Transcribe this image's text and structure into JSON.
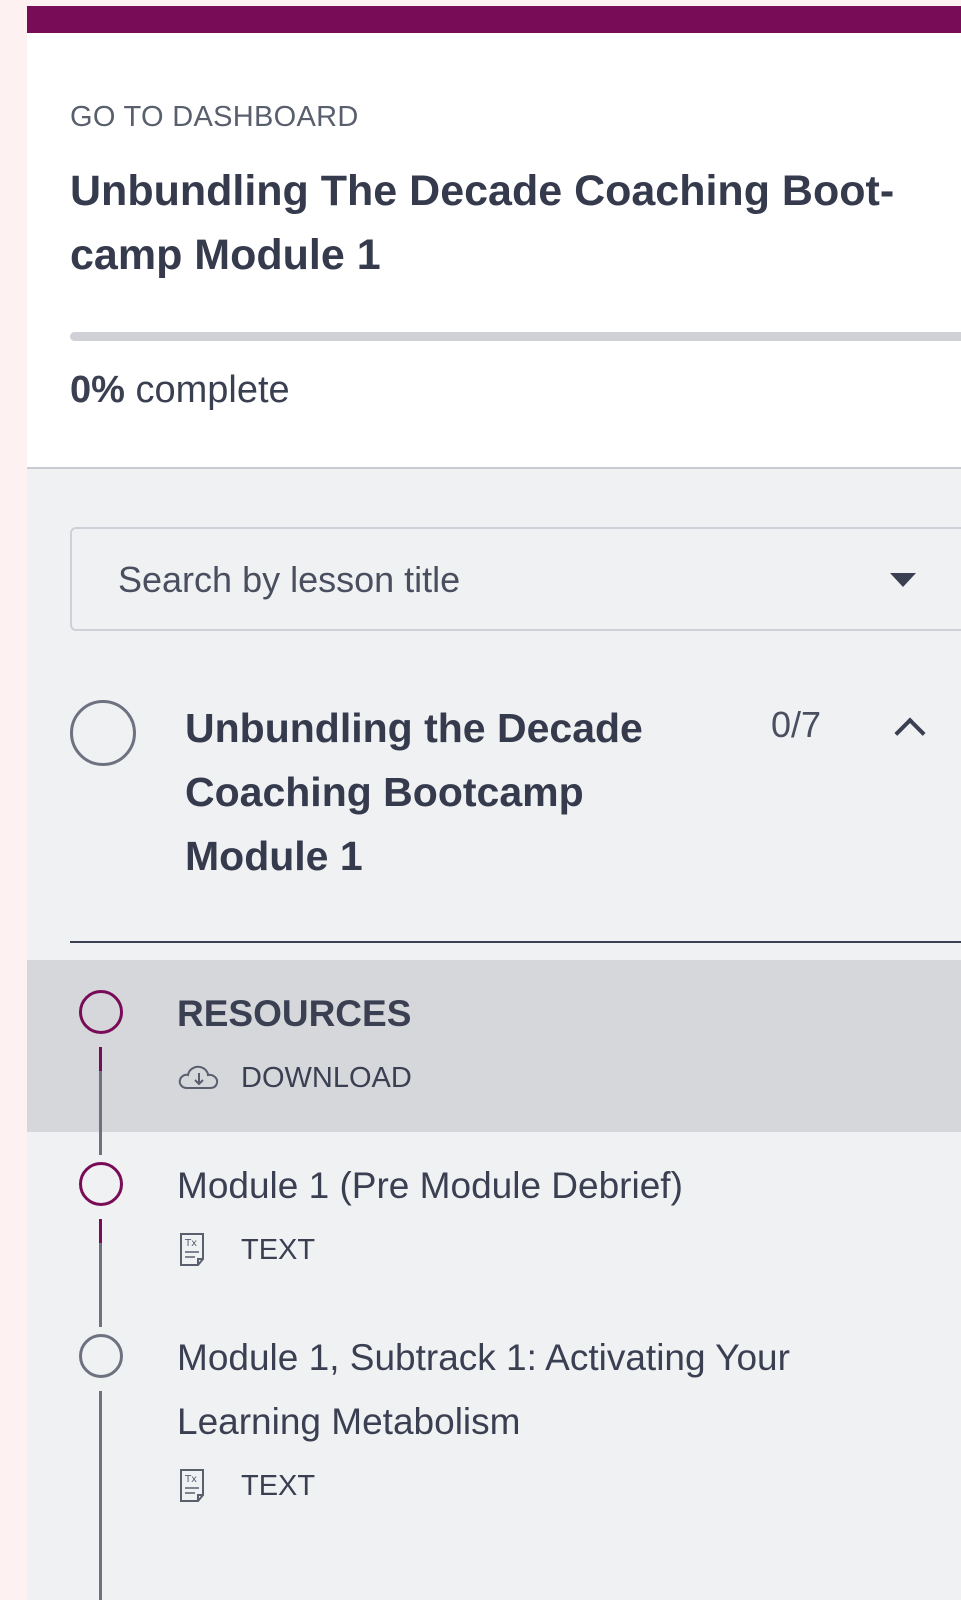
{
  "header": {
    "dashboard_link": "GO TO DASHBOARD",
    "course_title": "Unbundling The Decade Coaching Boot-camp Module 1",
    "progress_percent": "0%",
    "progress_value": 0,
    "progress_suffix": " complete"
  },
  "search": {
    "placeholder": "Search by lesson title"
  },
  "section": {
    "title": "Unbundling the Decade Coaching Bootcamp Module 1",
    "count": "0/7"
  },
  "lessons": [
    {
      "title": "RESOURCES",
      "type": "DOWNLOAD",
      "icon": "cloud-download-icon",
      "active": true
    },
    {
      "title": "Module 1 (Pre Module Debrief)",
      "type": "TEXT",
      "icon": "text-document-icon",
      "active": false
    },
    {
      "title": "Module 1, Subtrack 1: Activating Your Learning Metabolism",
      "type": "TEXT",
      "icon": "text-document-icon",
      "active": false
    }
  ],
  "colors": {
    "brand": "#790c57",
    "page_background": "#fdf1f1",
    "panel_background": "#f0f1f3",
    "active_row": "#d6d7db"
  }
}
